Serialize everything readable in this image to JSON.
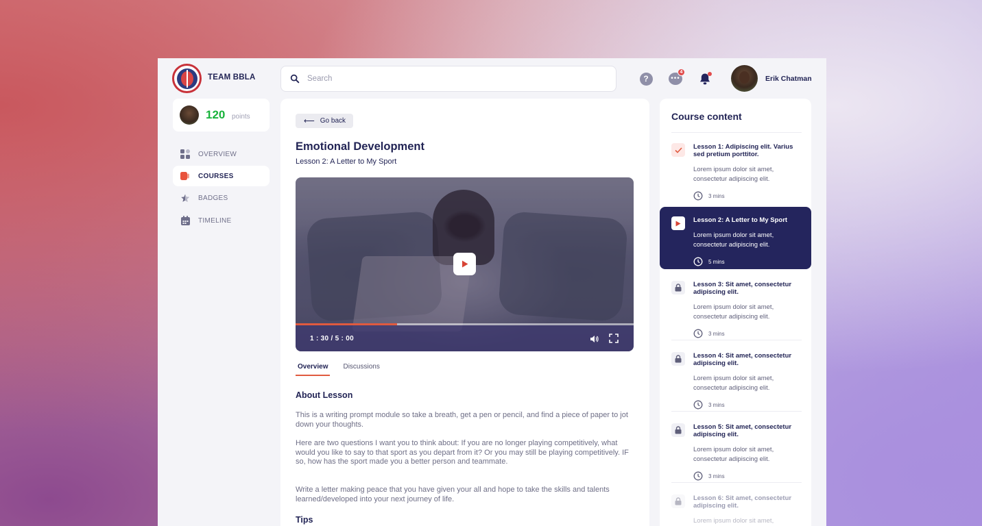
{
  "header": {
    "brand": "TEAM BBLA",
    "search_placeholder": "Search",
    "help_glyph": "?",
    "chat_glyph": "•••",
    "chat_badge": "4",
    "user_name": "Erik Chatman"
  },
  "sidebar": {
    "points_value": "120",
    "points_label": "points",
    "items": [
      {
        "label": "OVERVIEW",
        "icon": "grid-icon",
        "active": false
      },
      {
        "label": "COURSES",
        "icon": "courses-icon",
        "active": true
      },
      {
        "label": "BADGES",
        "icon": "star-icon",
        "active": false
      },
      {
        "label": "TIMELINE",
        "icon": "calendar-icon",
        "active": false
      }
    ]
  },
  "main": {
    "go_back": "Go back",
    "go_back_arrow": "⟵",
    "title": "Emotional Development",
    "subtitle": "Lesson 2: A Letter to My Sport",
    "video": {
      "time": "1 : 30 / 5 : 00",
      "progress": 0.3
    },
    "tabs": [
      {
        "label": "Overview",
        "active": true
      },
      {
        "label": "Discussions",
        "active": false
      }
    ],
    "about_heading": "About Lesson",
    "paragraphs": [
      "This is a writing prompt module so take a breath, get a pen or pencil, and find a piece of paper to jot down your thoughts.",
      "Here are two questions I want you to think about: If you are no longer playing competitively, what would you like to say to that sport as you depart from it? Or you may still be playing competitively. IF so, how has the sport made you a better person and teammate.",
      "Write a letter making peace that you have given your all and hope to take the skills and talents learned/developed into your next journey of life."
    ],
    "tips_heading": "Tips"
  },
  "course": {
    "title": "Course content",
    "lessons": [
      {
        "title": "Lesson 1: Adipiscing elit. Varius sed pretium porttitor.",
        "desc": "Lorem ipsum dolor sit amet, consectetur adipiscing elit.",
        "duration": "3 mins",
        "status": "completed"
      },
      {
        "title": "Lesson 2: A Letter to My Sport",
        "desc": "Lorem ipsum dolor sit amet, consectetur adipiscing elit.",
        "duration": "5 mins",
        "status": "active"
      },
      {
        "title": "Lesson 3: Sit amet, consectetur adipiscing elit.",
        "desc": "Lorem ipsum dolor sit amet, consectetur adipiscing elit.",
        "duration": "3 mins",
        "status": "locked"
      },
      {
        "title": "Lesson 4: Sit amet, consectetur adipiscing elit.",
        "desc": "Lorem ipsum dolor sit amet, consectetur adipiscing elit.",
        "duration": "3 mins",
        "status": "locked"
      },
      {
        "title": "Lesson 5: Sit amet, consectetur adipiscing elit.",
        "desc": "Lorem ipsum dolor sit amet, consectetur adipiscing elit.",
        "duration": "3 mins",
        "status": "locked"
      },
      {
        "title": "Lesson 6: Sit amet, consectetur adipiscing elit.",
        "desc": "Lorem ipsum dolor sit amet, consectetur adipiscing elit.",
        "duration": "",
        "status": "locked"
      }
    ]
  },
  "colors": {
    "navy": "#222455",
    "accent": "#e05a3f",
    "points_green": "#18b33b",
    "badge_red": "#e14b4b"
  }
}
